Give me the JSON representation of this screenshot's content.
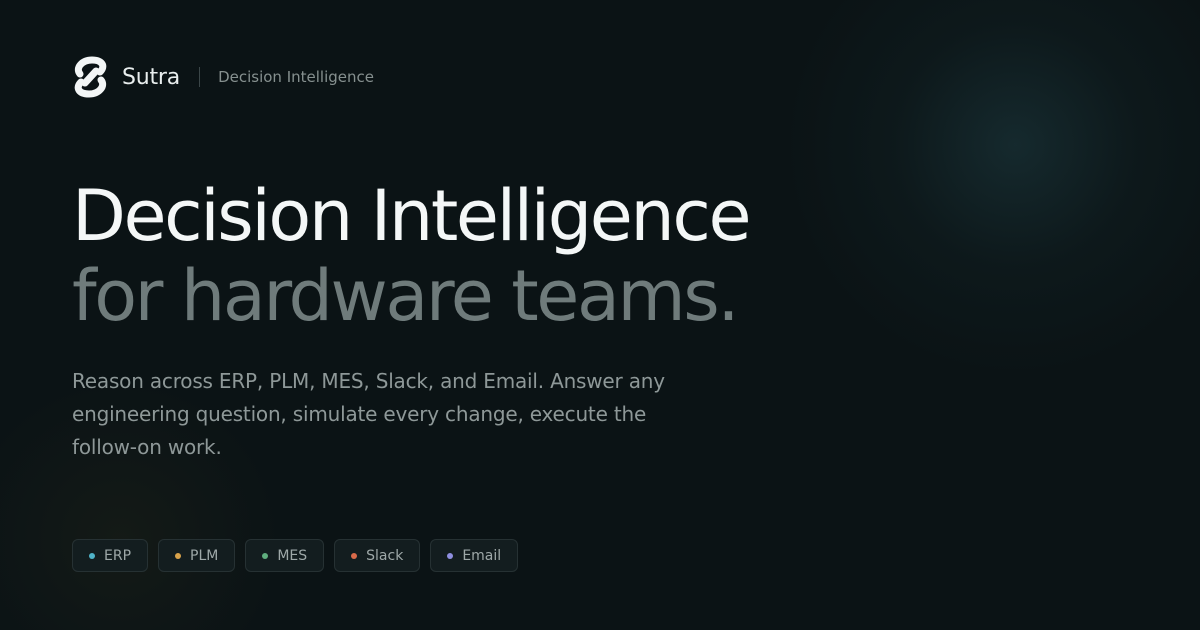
{
  "brand": {
    "name": "Sutra",
    "tagline": "Decision Intelligence",
    "logo_icon": "sutra-logo-icon"
  },
  "hero": {
    "headline_line1": "Decision Intelligence",
    "headline_line2": "for hardware teams.",
    "subtext": "Reason across ERP, PLM, MES, Slack, and Email. Answer any engineering question, simulate every change, execute the follow-on work."
  },
  "integrations": [
    {
      "label": "ERP",
      "dot_color": "#4fb3c8"
    },
    {
      "label": "PLM",
      "dot_color": "#d9a24a"
    },
    {
      "label": "MES",
      "dot_color": "#5fae7e"
    },
    {
      "label": "Slack",
      "dot_color": "#d96a4a"
    },
    {
      "label": "Email",
      "dot_color": "#8f8fe0"
    }
  ],
  "colors": {
    "background": "#0b1315",
    "headline_primary": "#f4f7f7",
    "headline_secondary": "#6f7b7b",
    "body_text": "#8e9898"
  }
}
